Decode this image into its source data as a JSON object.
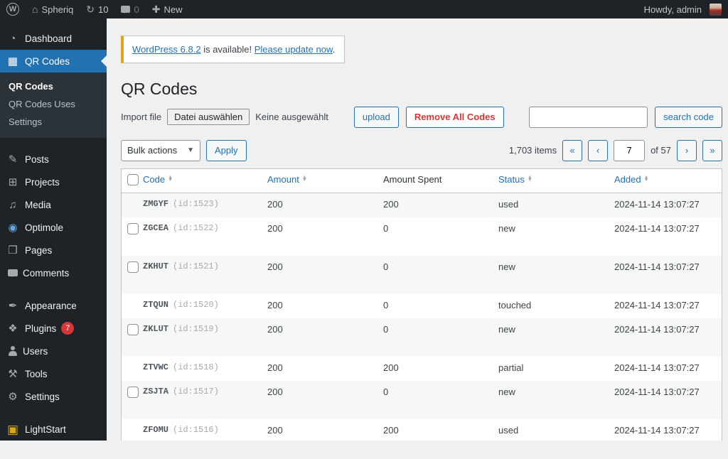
{
  "colors": {
    "accent": "#2271b1",
    "danger": "#d63638",
    "notice_border": "#dba617",
    "admin_bar_bg": "#1d2327",
    "sidebar_bg": "#1d2327",
    "submenu_bg": "#2c3338",
    "content_bg": "#f0f0f1",
    "row_stripe": "#f6f7f7"
  },
  "admin_bar": {
    "wp_logo": "W",
    "site_name": "Spheriq",
    "update_count": "10",
    "comment_count": "0",
    "new_label": "New",
    "howdy": "Howdy, admin"
  },
  "sidebar": {
    "items": [
      {
        "label": "Dashboard",
        "icon": "dashboard-icon",
        "glyph": "◔"
      },
      {
        "label": "QR Codes",
        "icon": "qr-codes-icon",
        "glyph": "▦",
        "active": true,
        "submenu": [
          {
            "label": "QR Codes",
            "current": true
          },
          {
            "label": "QR Codes Uses"
          },
          {
            "label": "Settings"
          }
        ]
      },
      {
        "separator": true
      },
      {
        "label": "Posts",
        "icon": "posts-icon",
        "glyph": "✎"
      },
      {
        "label": "Projects",
        "icon": "projects-icon",
        "glyph": "⊞"
      },
      {
        "label": "Media",
        "icon": "media-icon",
        "glyph": "♫"
      },
      {
        "label": "Optimole",
        "icon": "optimole-icon",
        "glyph": "◉"
      },
      {
        "label": "Pages",
        "icon": "pages-icon",
        "glyph": "❐"
      },
      {
        "label": "Comments",
        "icon": "comments-icon",
        "glyph": ""
      },
      {
        "separator": true
      },
      {
        "label": "Appearance",
        "icon": "appearance-icon",
        "glyph": "✒"
      },
      {
        "label": "Plugins",
        "icon": "plugins-icon",
        "glyph": "❖",
        "badge": "7"
      },
      {
        "label": "Users",
        "icon": "users-icon",
        "glyph": ""
      },
      {
        "label": "Tools",
        "icon": "tools-icon",
        "glyph": "⚒"
      },
      {
        "label": "Settings",
        "icon": "settings-icon",
        "glyph": "⚙"
      },
      {
        "separator": true
      },
      {
        "label": "LightStart",
        "icon": "lightstart-icon",
        "glyph": "▣"
      }
    ]
  },
  "notice": {
    "link1": "WordPress 6.8.2",
    "middle": " is available! ",
    "link2": "Please update now",
    "suffix": "."
  },
  "page": {
    "title": "QR Codes",
    "import_label": "Import file",
    "file_button": "Datei auswählen",
    "file_status": "Keine ausgewählt",
    "upload_button": "upload",
    "remove_button": "Remove All Codes",
    "search_value": "",
    "search_button": "search code",
    "bulk_actions_label": "Bulk actions",
    "apply_button": "Apply"
  },
  "pagination": {
    "items_count": "1,703 items",
    "first": "«",
    "prev": "‹",
    "current_page": "7",
    "of_label": "of 57",
    "next": "›",
    "last": "»"
  },
  "table": {
    "headers": [
      {
        "label": "Code",
        "sortable": true
      },
      {
        "label": "Amount",
        "sortable": true
      },
      {
        "label": "Amount Spent",
        "sortable": false
      },
      {
        "label": "Status",
        "sortable": true
      },
      {
        "label": "Added",
        "sortable": true
      }
    ],
    "rows": [
      {
        "code": "ZMGYF",
        "id": "(id:1523)",
        "amount": "200",
        "spent": "200",
        "status": "used",
        "added": "2024-11-14 13:07:27",
        "checkbox": false
      },
      {
        "code": "ZGCEA",
        "id": "(id:1522)",
        "amount": "200",
        "spent": "0",
        "status": "new",
        "added": "2024-11-14 13:07:27",
        "checkbox": true
      },
      {
        "code": "ZKHUT",
        "id": "(id:1521)",
        "amount": "200",
        "spent": "0",
        "status": "new",
        "added": "2024-11-14 13:07:27",
        "checkbox": true
      },
      {
        "code": "ZTQUN",
        "id": "(id:1520)",
        "amount": "200",
        "spent": "0",
        "status": "touched",
        "added": "2024-11-14 13:07:27",
        "checkbox": false
      },
      {
        "code": "ZKLUT",
        "id": "(id:1519)",
        "amount": "200",
        "spent": "0",
        "status": "new",
        "added": "2024-11-14 13:07:27",
        "checkbox": true
      },
      {
        "code": "ZTVWC",
        "id": "(id:1518)",
        "amount": "200",
        "spent": "200",
        "status": "partial",
        "added": "2024-11-14 13:07:27",
        "checkbox": false
      },
      {
        "code": "ZSJTA",
        "id": "(id:1517)",
        "amount": "200",
        "spent": "0",
        "status": "new",
        "added": "2024-11-14 13:07:27",
        "checkbox": true
      },
      {
        "code": "ZFOMU",
        "id": "(id:1516)",
        "amount": "200",
        "spent": "200",
        "status": "used",
        "added": "2024-11-14 13:07:27",
        "checkbox": false
      }
    ]
  }
}
